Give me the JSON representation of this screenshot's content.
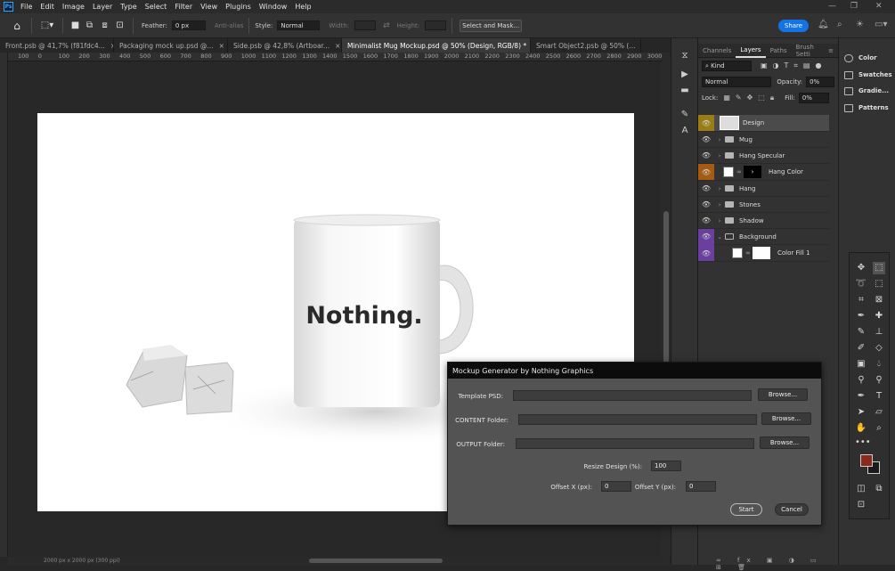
{
  "menubar": {
    "logo": "Ps",
    "items": [
      "File",
      "Edit",
      "Image",
      "Layer",
      "Type",
      "Select",
      "Filter",
      "View",
      "Plugins",
      "Window",
      "Help"
    ]
  },
  "options": {
    "feather_label": "Feather:",
    "feather_value": "0 px",
    "antialias": "Anti-alias",
    "style_label": "Style:",
    "style_value": "Normal",
    "width_label": "Width:",
    "height_label": "Height:",
    "select_mask": "Select and Mask...",
    "share": "Share"
  },
  "tabs": [
    {
      "label": "Front.psb @ 41,7% (f81fdc4..."
    },
    {
      "label": "Packaging mock up.psd @..."
    },
    {
      "label": "Side.psb @ 42,8% (Artboar..."
    },
    {
      "label": "Minimalist Mug Mockup.psd @ 50% (Design, RGB/8) *"
    },
    {
      "label": "Smart Object2.psb @ 50% (..."
    }
  ],
  "ruler": [
    "100",
    "0",
    "100",
    "200",
    "300",
    "400",
    "500",
    "600",
    "700",
    "800",
    "900",
    "1000",
    "1100",
    "1200",
    "1300",
    "1400",
    "1500",
    "1600",
    "1700",
    "1800",
    "1900",
    "2000",
    "2100",
    "2200",
    "2300",
    "2400",
    "2500",
    "2600",
    "2700",
    "2800",
    "2900",
    "3000",
    "310"
  ],
  "mug_text": "Nothing.",
  "status_text": "2000 px x 2000 px (300 ppi)",
  "layers_panel": {
    "tabs": [
      "Channels",
      "Layers",
      "Paths",
      "Brush Setti"
    ],
    "kind": "Kind",
    "blend": "Normal",
    "opacity_label": "Opacity:",
    "opacity_value": "0%",
    "lock_label": "Lock:",
    "fill_label": "Fill:",
    "fill_value": "0%",
    "layers": [
      {
        "name": "Design"
      },
      {
        "name": "Mug"
      },
      {
        "name": "Hang Specular"
      },
      {
        "name": "Hang Color"
      },
      {
        "name": "Hang"
      },
      {
        "name": "Stones"
      },
      {
        "name": "Shadow"
      },
      {
        "name": "Background"
      },
      {
        "name": "Color Fill 1"
      }
    ]
  },
  "right_panels": [
    "Color",
    "Swatches",
    "Gradie...",
    "Patterns"
  ],
  "colors": {
    "foreground": "#8b2a1a",
    "background": "#1a1a1a",
    "accent": "#1473e6"
  },
  "dialog": {
    "title": "Mockup Generator by Nothing Graphics",
    "template_label": "Template PSD:",
    "content_label": "CONTENT Folder:",
    "output_label": "OUTPUT Folder:",
    "browse": "Browse...",
    "resize_label": "Resize Design (%):",
    "resize_value": "100",
    "offset_x_label": "Offset X (px):",
    "offset_x_value": "0",
    "offset_y_label": "Offset Y (px):",
    "offset_y_value": "0",
    "start": "Start",
    "cancel": "Cancel"
  }
}
